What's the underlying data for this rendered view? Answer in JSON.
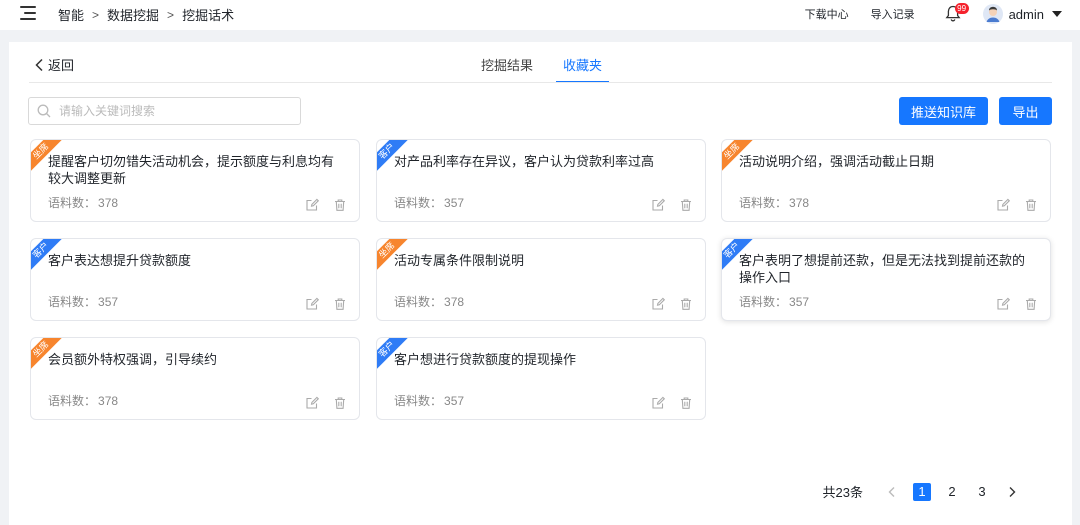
{
  "header": {
    "breadcrumb": [
      "智能",
      "数据挖掘",
      "挖掘话术"
    ],
    "links": [
      "下载中心",
      "导入记录"
    ],
    "notification_count": "99",
    "user_name": "admin"
  },
  "page": {
    "back_label": "返回",
    "tabs": [
      {
        "label": "挖掘结果",
        "active": false
      },
      {
        "label": "收藏夹",
        "active": true
      }
    ],
    "search_placeholder": "请输入关键词搜索",
    "push_button": "推送知识库",
    "export_button": "导出"
  },
  "cards": [
    {
      "tag": "坐席",
      "tag_color": "#f7852e",
      "title": "提醒客户切勿错失活动机会，提示额度与利息均有较大调整更新",
      "count_label": "语料数：",
      "count": "378"
    },
    {
      "tag": "客户",
      "tag_color": "#2f7cf6",
      "title": "对产品利率存在异议，客户认为贷款利率过高",
      "count_label": "语料数：",
      "count": "357"
    },
    {
      "tag": "坐席",
      "tag_color": "#f7852e",
      "title": "活动说明介绍，强调活动截止日期",
      "count_label": "语料数：",
      "count": "378"
    },
    {
      "tag": "客户",
      "tag_color": "#2f7cf6",
      "title": "客户表达想提升贷款额度",
      "count_label": "语料数：",
      "count": "357"
    },
    {
      "tag": "坐席",
      "tag_color": "#f7852e",
      "title": "活动专属条件限制说明",
      "count_label": "语料数：",
      "count": "378"
    },
    {
      "tag": "客户",
      "tag_color": "#2f7cf6",
      "title": "客户表明了想提前还款，但是无法找到提前还款的操作入口",
      "count_label": "语料数：",
      "count": "357"
    },
    {
      "tag": "坐席",
      "tag_color": "#f7852e",
      "title": "会员额外特权强调，引导续约",
      "count_label": "语料数：",
      "count": "378"
    },
    {
      "tag": "客户",
      "tag_color": "#2f7cf6",
      "title": "客户想进行贷款额度的提现操作",
      "count_label": "语料数：",
      "count": "357"
    }
  ],
  "pagination": {
    "total_label": "共23条",
    "pages": [
      "1",
      "2",
      "3"
    ],
    "current_page": "1"
  },
  "colors": {
    "primary": "#1677ff",
    "tag_agent": "#f7852e",
    "tag_customer": "#2f7cf6",
    "badge": "#f5222d"
  }
}
